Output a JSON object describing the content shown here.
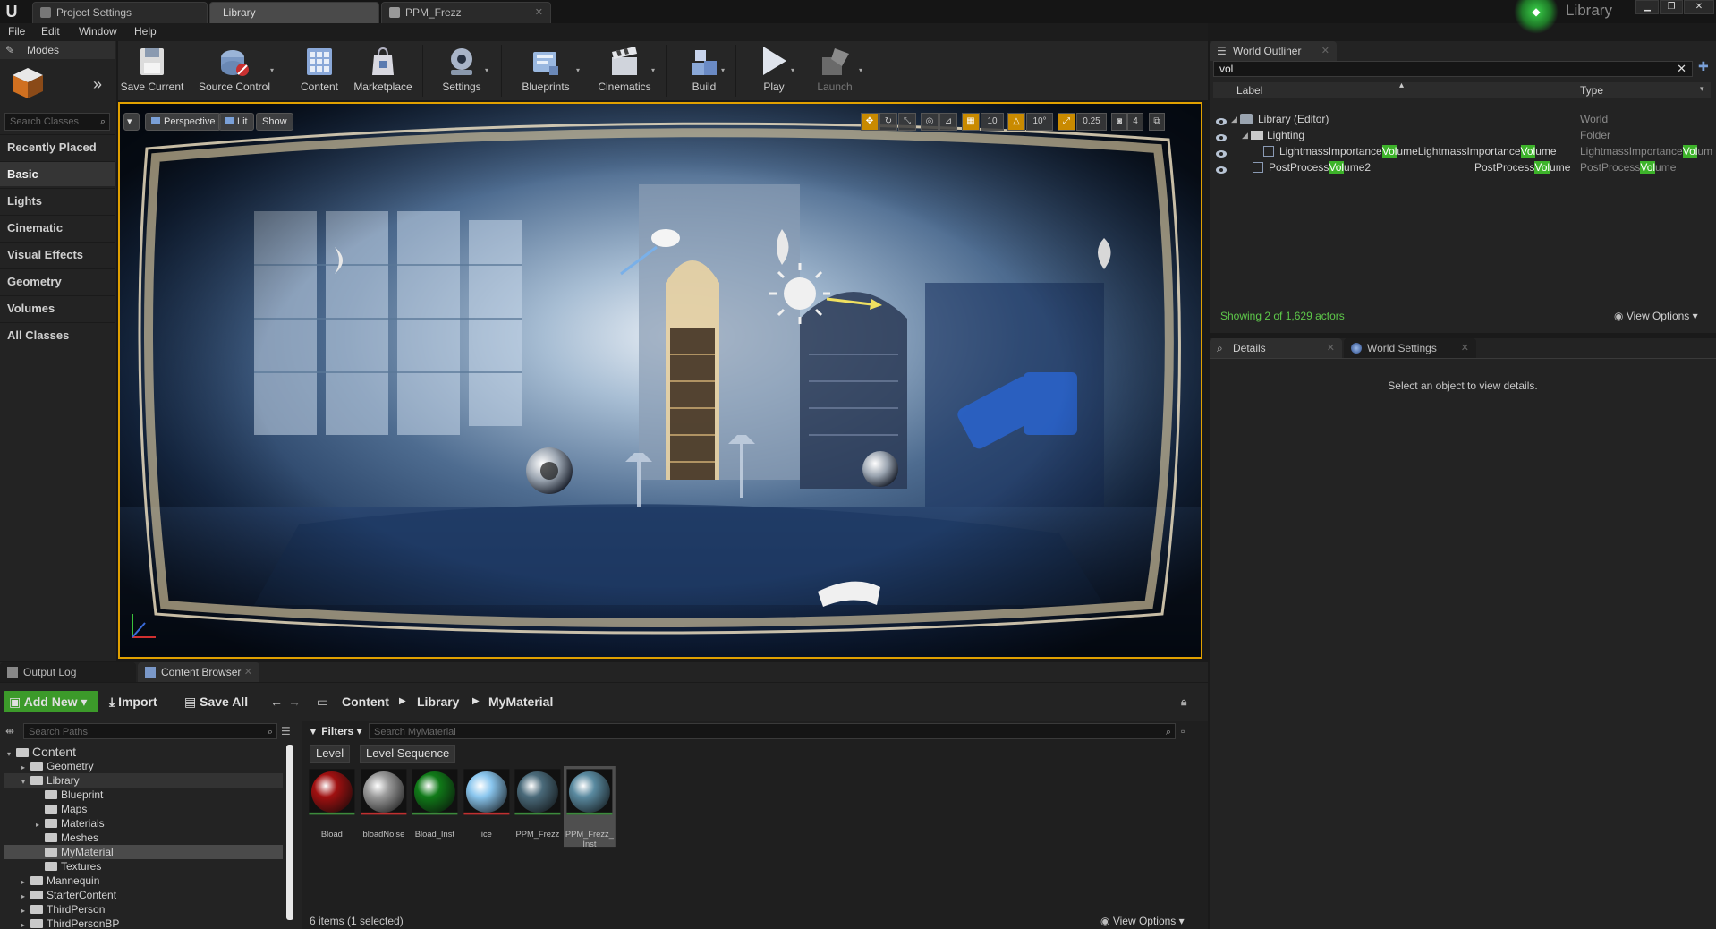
{
  "titlebar": {
    "tabs": [
      {
        "label": "Project Settings",
        "active": false
      },
      {
        "label": "Library",
        "active": true
      },
      {
        "label": "PPM_Frezz",
        "active": false
      }
    ],
    "project_name": "Library"
  },
  "menu": [
    "File",
    "Edit",
    "Window",
    "Help"
  ],
  "modes": {
    "tab_label": "Modes",
    "search_placeholder": "Search Classes",
    "categories": [
      "Recently Placed",
      "Basic",
      "Lights",
      "Cinematic",
      "Visual Effects",
      "Geometry",
      "Volumes",
      "All Classes"
    ],
    "active_category": "Basic"
  },
  "toolbar": {
    "save_current": "Save Current",
    "source_control": "Source Control",
    "content": "Content",
    "marketplace": "Marketplace",
    "settings": "Settings",
    "blueprints": "Blueprints",
    "cinematics": "Cinematics",
    "build": "Build",
    "play": "Play",
    "launch": "Launch"
  },
  "viewport": {
    "perspective": "Perspective",
    "lit": "Lit",
    "show": "Show",
    "grid_snap": "10",
    "rotation_snap": "10°",
    "scale_snap": "0.25",
    "camera_speed": "4"
  },
  "outliner": {
    "tab_label": "World Outliner",
    "search_value": "vol",
    "col_label": "Label",
    "col_type": "Type",
    "rows": [
      {
        "label": "Library (Editor)",
        "type": "World"
      },
      {
        "label": "Lighting",
        "type": "Folder"
      },
      {
        "label_pre": "LightmassImportance",
        "label_hl": "Vol",
        "label_post": "umeLightmassImportance",
        "label_hl2": "Vol",
        "label_post2": "ume",
        "type_pre": "LightmassImportance",
        "type_hl": "Vol",
        "type_post": "um"
      },
      {
        "label_pre": "PostProcess",
        "label_hl": "Vol",
        "label_post": "ume2",
        "mid_pre": "PostProcess",
        "mid_hl": "Vol",
        "mid_post": "ume",
        "type_pre": "PostProcess",
        "type_hl": "Vol",
        "type_post": "ume"
      }
    ],
    "status": "Showing 2 of 1,629 actors",
    "view_options": "View Options"
  },
  "details": {
    "tab_label": "Details",
    "world_settings_label": "World Settings",
    "empty_message": "Select an object to view details."
  },
  "bottom": {
    "output_log": "Output Log",
    "content_browser": "Content Browser",
    "add_new": "Add New",
    "import": "Import",
    "save_all": "Save All",
    "breadcrumb": [
      "Content",
      "Library",
      "MyMaterial"
    ],
    "search_paths_placeholder": "Search Paths",
    "filters": "Filters",
    "search_assets_placeholder": "Search MyMaterial",
    "filter_chips": [
      "Level",
      "Level Sequence"
    ],
    "tree": [
      {
        "label": "Content",
        "indent": 0,
        "arrow": "▾",
        "big": true
      },
      {
        "label": "Geometry",
        "indent": 1,
        "arrow": "▸"
      },
      {
        "label": "Library",
        "indent": 1,
        "arrow": "▾",
        "selected_parent": true
      },
      {
        "label": "Blueprint",
        "indent": 2,
        "arrow": ""
      },
      {
        "label": "Maps",
        "indent": 2,
        "arrow": ""
      },
      {
        "label": "Materials",
        "indent": 2,
        "arrow": "▸"
      },
      {
        "label": "Meshes",
        "indent": 2,
        "arrow": ""
      },
      {
        "label": "MyMaterial",
        "indent": 2,
        "arrow": "",
        "selected": true
      },
      {
        "label": "Textures",
        "indent": 2,
        "arrow": ""
      },
      {
        "label": "Mannequin",
        "indent": 1,
        "arrow": "▸"
      },
      {
        "label": "StarterContent",
        "indent": 1,
        "arrow": "▸"
      },
      {
        "label": "ThirdPerson",
        "indent": 1,
        "arrow": "▸"
      },
      {
        "label": "ThirdPersonBP",
        "indent": 1,
        "arrow": "▸"
      }
    ],
    "assets": [
      {
        "name": "Bload",
        "color": "#a01010",
        "bar": "#3c8a3c"
      },
      {
        "name": "bloadNoise",
        "color": "#9a9a9a",
        "bar": "#c03030"
      },
      {
        "name": "Bload_Inst",
        "color": "#107a18",
        "bar": "#3c8a3c"
      },
      {
        "name": "ice",
        "color": "#8ac6ee",
        "bar": "#c03030"
      },
      {
        "name": "PPM_Frezz",
        "color": "#4a6a7a",
        "bar": "#3c8a3c"
      },
      {
        "name": "PPM_Frezz_\nInst",
        "color": "#5a8aa0",
        "bar": "#3c8a3c"
      }
    ],
    "item_count": "6 items (1 selected)",
    "view_options": "View Options"
  }
}
